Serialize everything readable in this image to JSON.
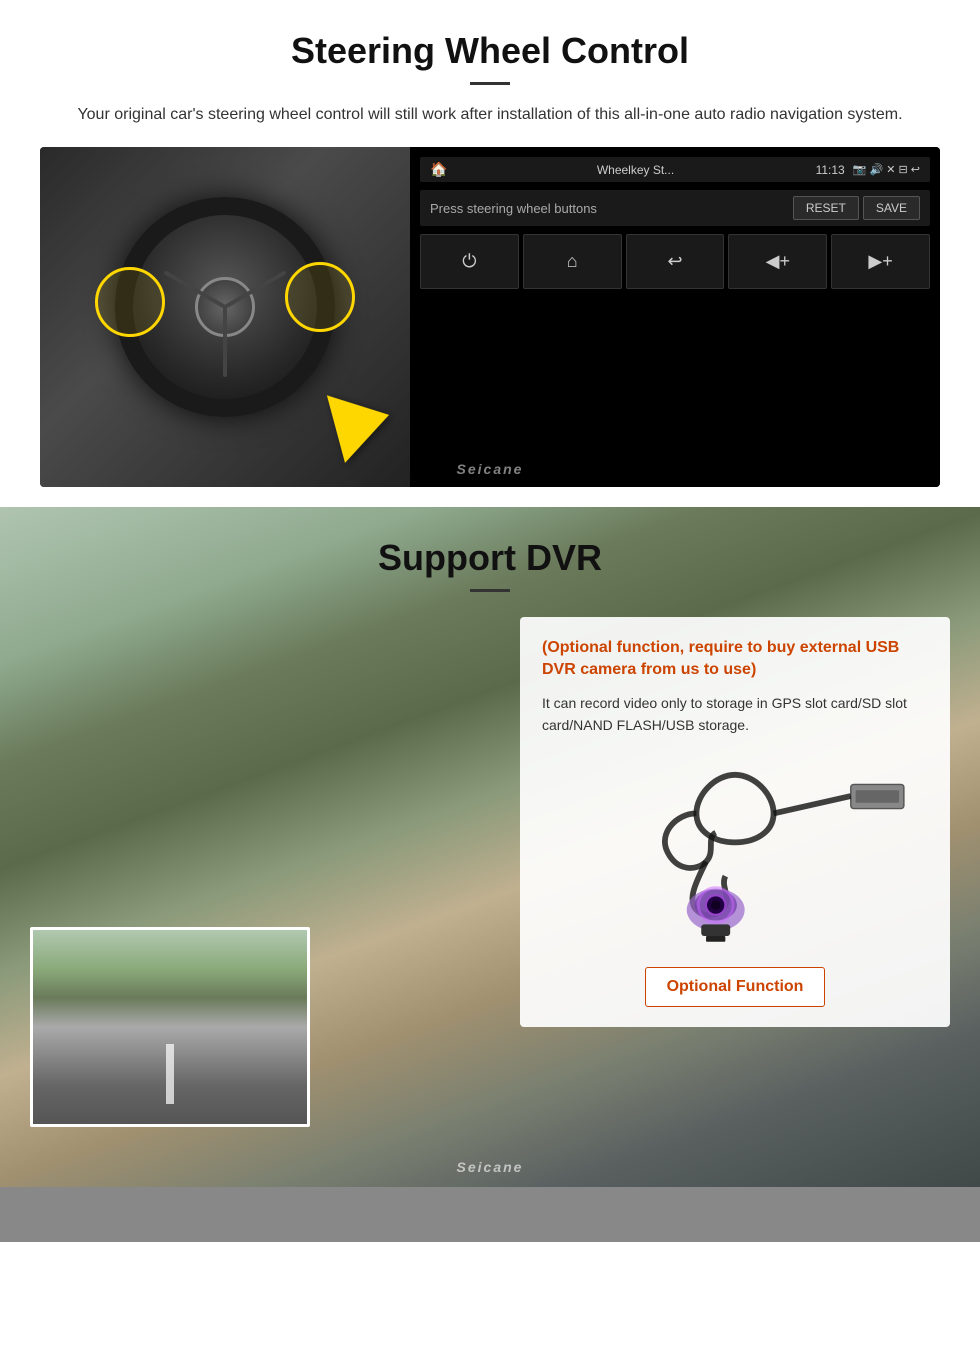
{
  "steering_section": {
    "title": "Steering Wheel Control",
    "description": "Your original car's steering wheel control will still work after installation of this all-in-one auto radio navigation system.",
    "screen": {
      "app_name": "Wheelkey St...",
      "time": "11:13",
      "prompt": "Press steering wheel buttons",
      "reset_btn": "RESET",
      "save_btn": "SAVE",
      "controls": [
        {
          "icon": "⏻",
          "label": "power"
        },
        {
          "icon": "⌂",
          "label": "home"
        },
        {
          "icon": "↩",
          "label": "back"
        },
        {
          "icon": "🔊+",
          "label": "vol-up"
        },
        {
          "icon": "🔊+",
          "label": "vol-up-2"
        }
      ]
    },
    "watermark": "Seicane"
  },
  "dvr_section": {
    "title": "Support DVR",
    "optional_note": "(Optional function, require to buy external USB DVR camera from us to use)",
    "description": "It can record video only to storage in GPS slot card/SD slot card/NAND FLASH/USB storage.",
    "optional_btn_label": "Optional Function",
    "watermark": "Seicane"
  }
}
